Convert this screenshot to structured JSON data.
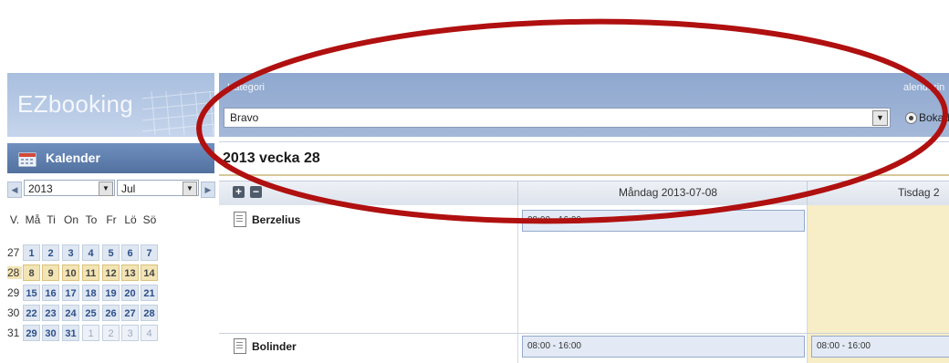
{
  "app": {
    "logo_text": "EZbooking"
  },
  "kalender": {
    "title": "Kalender",
    "year": "2013",
    "month": "Jul",
    "day_headers": [
      "V.",
      "Må",
      "Ti",
      "On",
      "To",
      "Fr",
      "Lö",
      "Sö"
    ],
    "weeks": [
      {
        "week": "27",
        "days": [
          "1",
          "2",
          "3",
          "4",
          "5",
          "6",
          "7"
        ]
      },
      {
        "week": "28",
        "days": [
          "8",
          "9",
          "10",
          "11",
          "12",
          "13",
          "14"
        ],
        "current": true
      },
      {
        "week": "29",
        "days": [
          "15",
          "16",
          "17",
          "18",
          "19",
          "20",
          "21"
        ]
      },
      {
        "week": "30",
        "days": [
          "22",
          "23",
          "24",
          "25",
          "26",
          "27",
          "28"
        ]
      },
      {
        "week": "31",
        "days": [
          "29",
          "30",
          "31",
          "1",
          "2",
          "3",
          "4"
        ]
      }
    ]
  },
  "category": {
    "label": "Kategori",
    "selected": "Bravo",
    "calendar_label_partial": "alenderin",
    "radio_label_partial": "Bokad"
  },
  "week_title": "2013 vecka 28",
  "schedule": {
    "columns": [
      "Måndag 2013-07-08",
      "Tisdag 2"
    ],
    "rows": [
      {
        "name": "Berzelius",
        "monday_slot": "08:00 - 16:00",
        "tuesday_slot": ""
      },
      {
        "name": "Bolinder",
        "monday_slot": "08:00 - 16:00",
        "tuesday_slot": "08:00 - 16:00"
      }
    ]
  },
  "colors": {
    "annotation": "#b01010",
    "current_week": "#f3e4b4",
    "header_blue": "#52719f"
  }
}
